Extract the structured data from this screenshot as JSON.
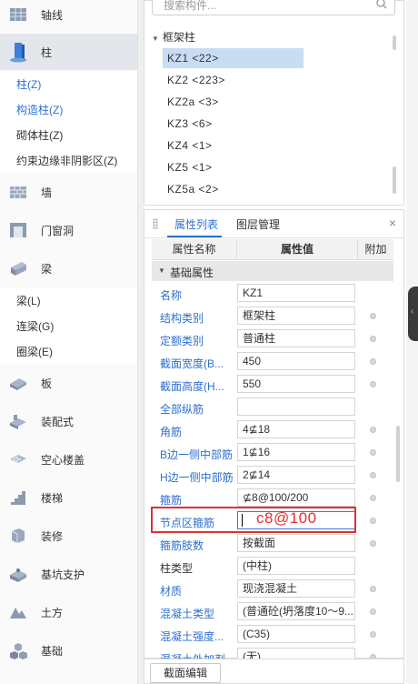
{
  "nav": {
    "axis": {
      "label": "轴线",
      "icon": "axis-grid-icon"
    },
    "column": {
      "label": "柱",
      "icon": "column-icon"
    },
    "column_subs": [
      "柱(Z)",
      "构造柱(Z)",
      "砌体柱(Z)",
      "约束边缘非阴影区(Z)"
    ],
    "wall": {
      "label": "墙",
      "icon": "wall-icon"
    },
    "door": {
      "label": "门窗洞",
      "icon": "door-window-icon"
    },
    "beam": {
      "label": "梁",
      "icon": "beam-icon"
    },
    "beam_subs": [
      "梁(L)",
      "连梁(G)",
      "圈梁(E)"
    ],
    "slab": {
      "label": "板",
      "icon": "slab-icon"
    },
    "prefab": {
      "label": "装配式",
      "icon": "prefab-icon"
    },
    "hollow": {
      "label": "空心楼盖",
      "icon": "hollow-floor-icon"
    },
    "stair": {
      "label": "楼梯",
      "icon": "stair-icon"
    },
    "decor": {
      "label": "装修",
      "icon": "decoration-icon"
    },
    "pit": {
      "label": "基坑支护",
      "icon": "pit-support-icon"
    },
    "earth": {
      "label": "土方",
      "icon": "earthwork-icon"
    },
    "found": {
      "label": "基础",
      "icon": "foundation-icon"
    }
  },
  "component_list": {
    "search_placeholder": "搜索构件...",
    "group": "框架柱",
    "items": [
      "KZ1 <22>",
      "KZ2 <223>",
      "KZ2a <3>",
      "KZ3 <6>",
      "KZ4 <1>",
      "KZ5 <1>",
      "KZ5a <2>"
    ],
    "selected_index": 0
  },
  "panel": {
    "tab_properties": "属性列表",
    "tab_layers": "图层管理",
    "close": "×",
    "col_name": "属性名称",
    "col_value": "属性值",
    "col_extra": "附加",
    "section": "基础属性"
  },
  "properties": [
    {
      "name": "名称",
      "value": "KZ1"
    },
    {
      "name": "结构类别",
      "value": "框架柱"
    },
    {
      "name": "定额类别",
      "value": "普通柱"
    },
    {
      "name": "截面宽度(B...",
      "value": "450"
    },
    {
      "name": "截面高度(H...",
      "value": "550"
    },
    {
      "name": "全部纵筋",
      "value": ""
    },
    {
      "name": "角筋",
      "value": "4⊈18"
    },
    {
      "name": "B边一侧中部筋",
      "value": "1⊈16"
    },
    {
      "name": "H边一侧中部筋",
      "value": "2⊈14"
    },
    {
      "name": "箍筋",
      "value": "⊈8@100/200"
    },
    {
      "name": "节点区箍筋",
      "value": "c8@100"
    },
    {
      "name": "箍筋肢数",
      "value": "按截面"
    },
    {
      "name": "柱类型",
      "value": "(中柱)"
    },
    {
      "name": "材质",
      "value": "现浇混凝土"
    },
    {
      "name": "混凝土类型",
      "value": "(普通砼(坍落度10～9..."
    },
    {
      "name": "混凝土强度...",
      "value": "(C35)"
    },
    {
      "name": "混凝土外加剂",
      "value": "(无)"
    }
  ],
  "bottom": {
    "edit_button": "截面编辑"
  },
  "colors": {
    "link_blue": "#2d6fd1",
    "selected": "#c8dcf4",
    "highlight_red": "#e03030"
  }
}
